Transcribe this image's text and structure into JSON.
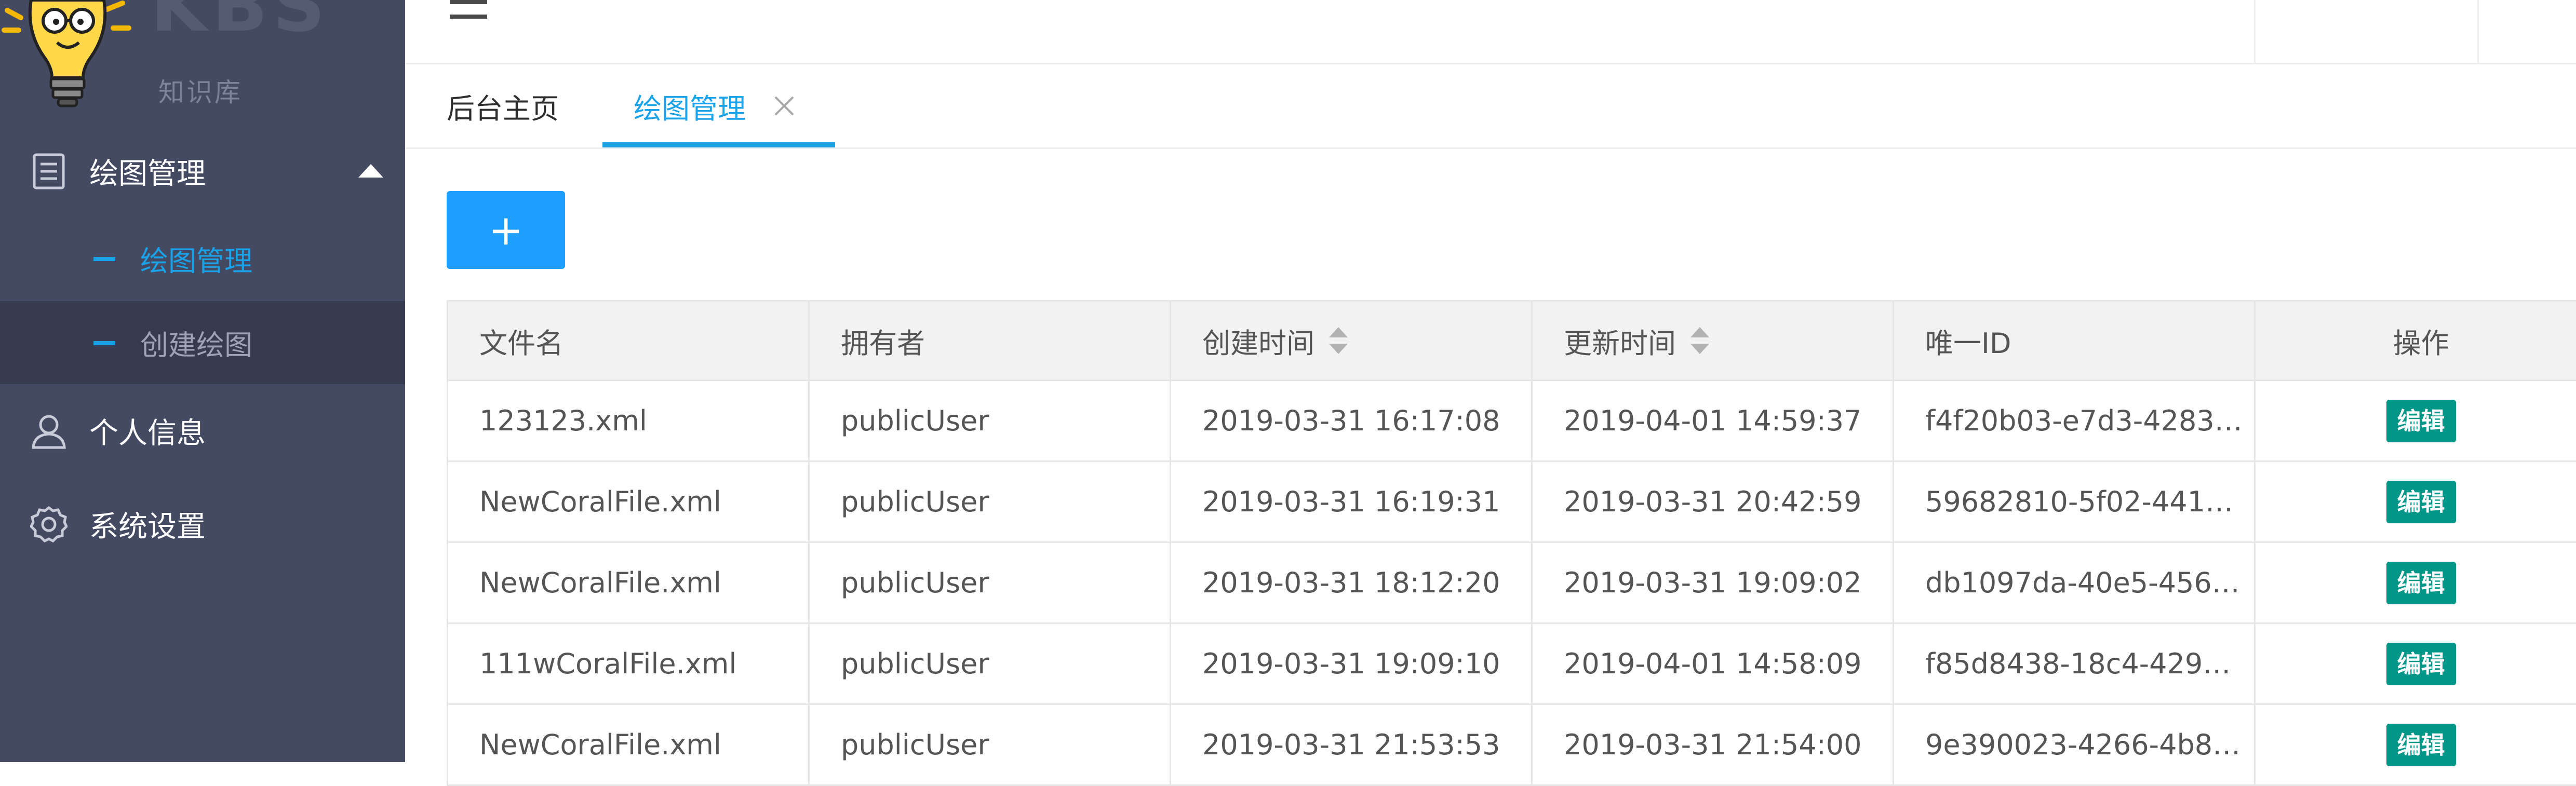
{
  "logo": {
    "text": "KBS",
    "subtitle": "知识库"
  },
  "sidebar": {
    "menu": [
      {
        "label": "绘图管理",
        "icon": "document-icon",
        "expanded": true,
        "children": [
          {
            "label": "绘图管理",
            "active": true
          },
          {
            "label": "创建绘图",
            "active": false
          }
        ]
      },
      {
        "label": "个人信息",
        "icon": "user-icon"
      },
      {
        "label": "系统设置",
        "icon": "gear-icon"
      }
    ]
  },
  "tabs": [
    {
      "label": "后台主页",
      "active": false
    },
    {
      "label": "绘图管理",
      "active": true,
      "closable": true
    }
  ],
  "toolbar": {
    "add_label": "+"
  },
  "table": {
    "columns": [
      "文件名",
      "拥有者",
      "创建时间",
      "更新时间",
      "唯一ID",
      "操作"
    ],
    "sortable": [
      false,
      false,
      true,
      true,
      false,
      false
    ],
    "rows": [
      {
        "name": "123123.xml",
        "owner": "publicUser",
        "created": "2019-03-31 16:17:08",
        "updated": "2019-04-01 14:59:37",
        "uid": "f4f20b03-e7d3-4283…",
        "action": "编辑"
      },
      {
        "name": "NewCoralFile.xml",
        "owner": "publicUser",
        "created": "2019-03-31 16:19:31",
        "updated": "2019-03-31 20:42:59",
        "uid": "59682810-5f02-441…",
        "action": "编辑"
      },
      {
        "name": "NewCoralFile.xml",
        "owner": "publicUser",
        "created": "2019-03-31 18:12:20",
        "updated": "2019-03-31 19:09:02",
        "uid": "db1097da-40e5-456…",
        "action": "编辑"
      },
      {
        "name": "111wCoralFile.xml",
        "owner": "publicUser",
        "created": "2019-03-31 19:09:10",
        "updated": "2019-04-01 14:58:09",
        "uid": "f85d8438-18c4-429…",
        "action": "编辑"
      },
      {
        "name": "NewCoralFile.xml",
        "owner": "publicUser",
        "created": "2019-03-31 21:53:53",
        "updated": "2019-03-31 21:54:00",
        "uid": "9e390023-4266-4b8…",
        "action": "编辑"
      }
    ]
  },
  "colors": {
    "sidebar_bg": "#444a62",
    "sidebar_active_bg": "#363b4f",
    "accent": "#1aa3e8",
    "primary_button": "#1e9fff",
    "edit_button": "#009688"
  }
}
